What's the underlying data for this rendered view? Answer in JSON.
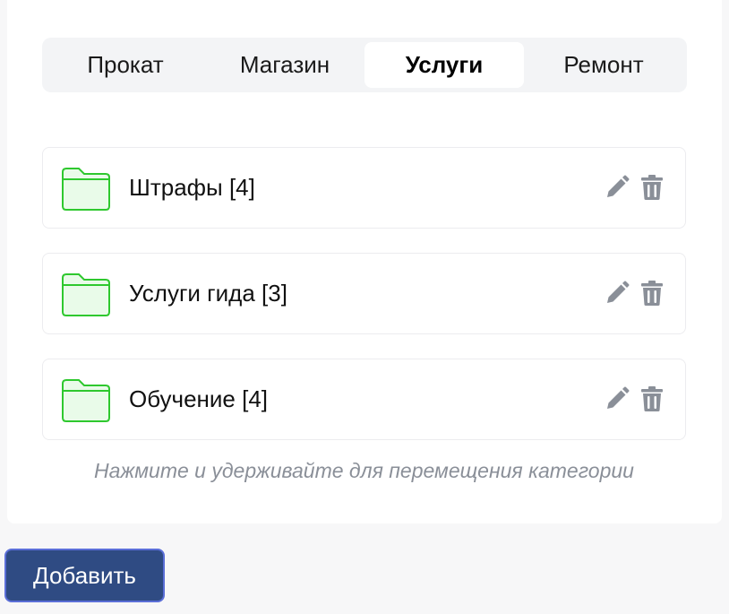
{
  "tabs": [
    {
      "label": "Прокат",
      "active": false
    },
    {
      "label": "Магазин",
      "active": false
    },
    {
      "label": "Услуги",
      "active": true
    },
    {
      "label": "Ремонт",
      "active": false
    }
  ],
  "categories": [
    {
      "label": "Штрафы [4]"
    },
    {
      "label": "Услуги гида [3]"
    },
    {
      "label": "Обучение [4]"
    }
  ],
  "icons": {
    "folder": "folder-icon",
    "edit": "pencil-icon",
    "delete": "trash-icon"
  },
  "colors": {
    "folder_stroke": "#2ec82e",
    "folder_fill": "#e9fbe9",
    "action_icon": "#8a8f98",
    "add_button_bg": "#2f4b83",
    "add_button_border": "#5b6fd8"
  },
  "hint": "Нажмите и удерживайте для перемещения категории",
  "add_button_label": "Добавить"
}
